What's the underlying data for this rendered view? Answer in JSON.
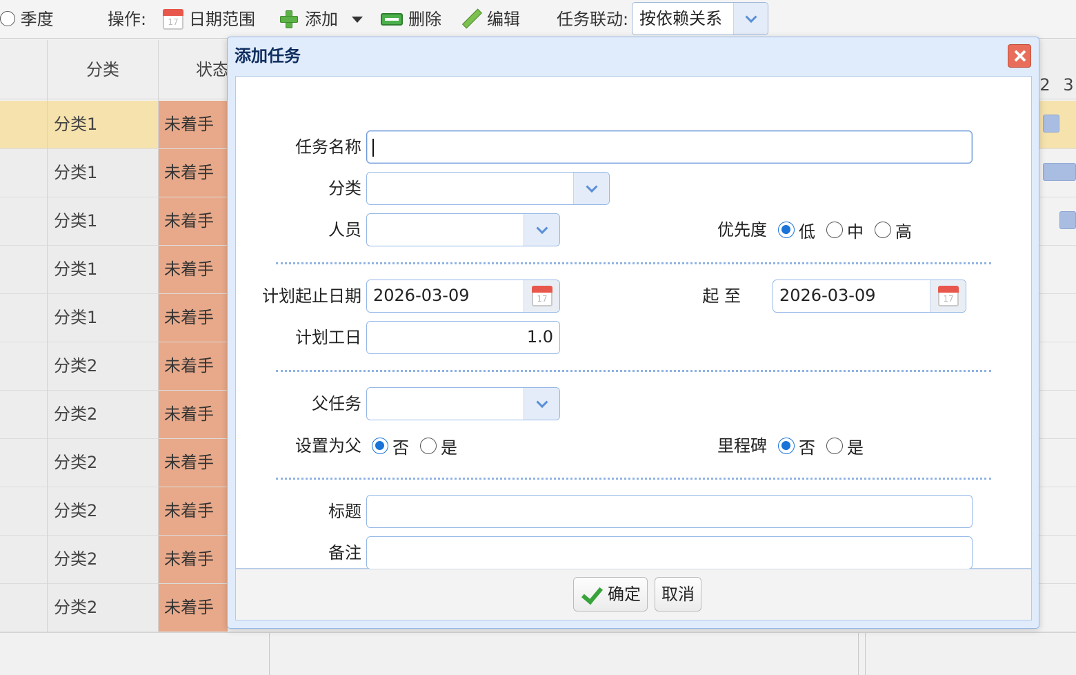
{
  "toolbar": {
    "season_label": "季度",
    "ops_label": "操作:",
    "date_range_label": "日期范围",
    "add_label": "添加",
    "delete_label": "删除",
    "edit_label": "编辑",
    "linkage_label": "任务联动:",
    "linkage_value": "按依赖关系"
  },
  "grid": {
    "headers": {
      "category": "分类",
      "status": "状态"
    },
    "timeline_ticks": [
      "2",
      "3"
    ],
    "rows": [
      {
        "category": "分类1",
        "status": "未着手",
        "selected": true
      },
      {
        "category": "分类1",
        "status": "未着手"
      },
      {
        "category": "分类1",
        "status": "未着手"
      },
      {
        "category": "分类1",
        "status": "未着手"
      },
      {
        "category": "分类1",
        "status": "未着手"
      },
      {
        "category": "分类2",
        "status": "未着手"
      },
      {
        "category": "分类2",
        "status": "未着手"
      },
      {
        "category": "分类2",
        "status": "未着手"
      },
      {
        "category": "分类2",
        "status": "未着手"
      },
      {
        "category": "分类2",
        "status": "未着手"
      },
      {
        "category": "分类2",
        "status": "未着手"
      }
    ]
  },
  "dialog": {
    "title": "添加任务",
    "fields": {
      "task_name": {
        "label": "任务名称",
        "value": ""
      },
      "category": {
        "label": "分类",
        "value": ""
      },
      "person": {
        "label": "人员",
        "value": ""
      },
      "priority": {
        "label": "优先度",
        "options": [
          "低",
          "中",
          "高"
        ],
        "selected": "低"
      },
      "plan_start": {
        "label": "计划起止日期",
        "value": "2026-03-09"
      },
      "plan_end": {
        "label": "起 至",
        "value": "2026-03-09"
      },
      "plan_days": {
        "label": "计划工日",
        "value": "1.0"
      },
      "parent_task": {
        "label": "父任务",
        "value": ""
      },
      "set_as_parent": {
        "label": "设置为父",
        "options": [
          "否",
          "是"
        ],
        "selected": "否"
      },
      "milestone": {
        "label": "里程碑",
        "options": [
          "否",
          "是"
        ],
        "selected": "否"
      },
      "title": {
        "label": "标题",
        "value": ""
      },
      "remark": {
        "label": "备注",
        "value": ""
      }
    },
    "buttons": {
      "ok": "确定",
      "cancel": "取消"
    }
  },
  "colors": {
    "status_cell": "#e8a98a",
    "selected_row": "#f5e2ad",
    "dialog_border": "#95b8e7",
    "radio_on": "#1a73d9"
  }
}
